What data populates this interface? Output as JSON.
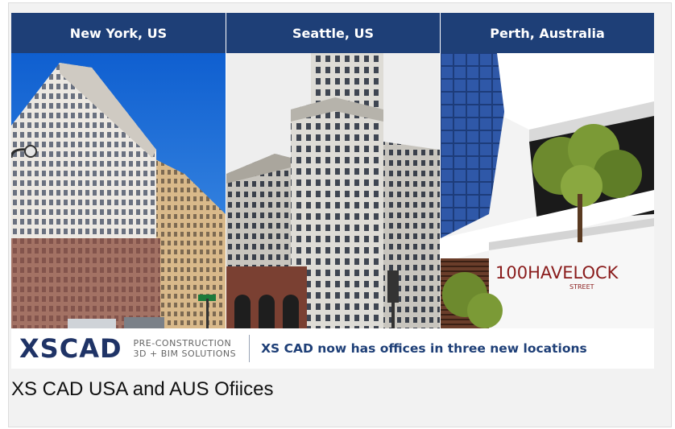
{
  "locations": [
    {
      "label": "New York, US"
    },
    {
      "label": "Seattle, US"
    },
    {
      "label": "Perth, Australia"
    }
  ],
  "logo": {
    "text": "XSCAD",
    "tagline_line1": "PRE-CONSTRUCTION",
    "tagline_line2": "3D + BIM SOLUTIONS"
  },
  "headline": "XS CAD now has offices in three new locations",
  "sign_text": "100HAVELOCK",
  "sign_subtext": "STREET",
  "caption": "XS CAD USA and AUS Ofiices",
  "colors": {
    "header_bg": "#1e3f77",
    "logo": "#1f3366",
    "sky_blue": "#1a73d8"
  }
}
